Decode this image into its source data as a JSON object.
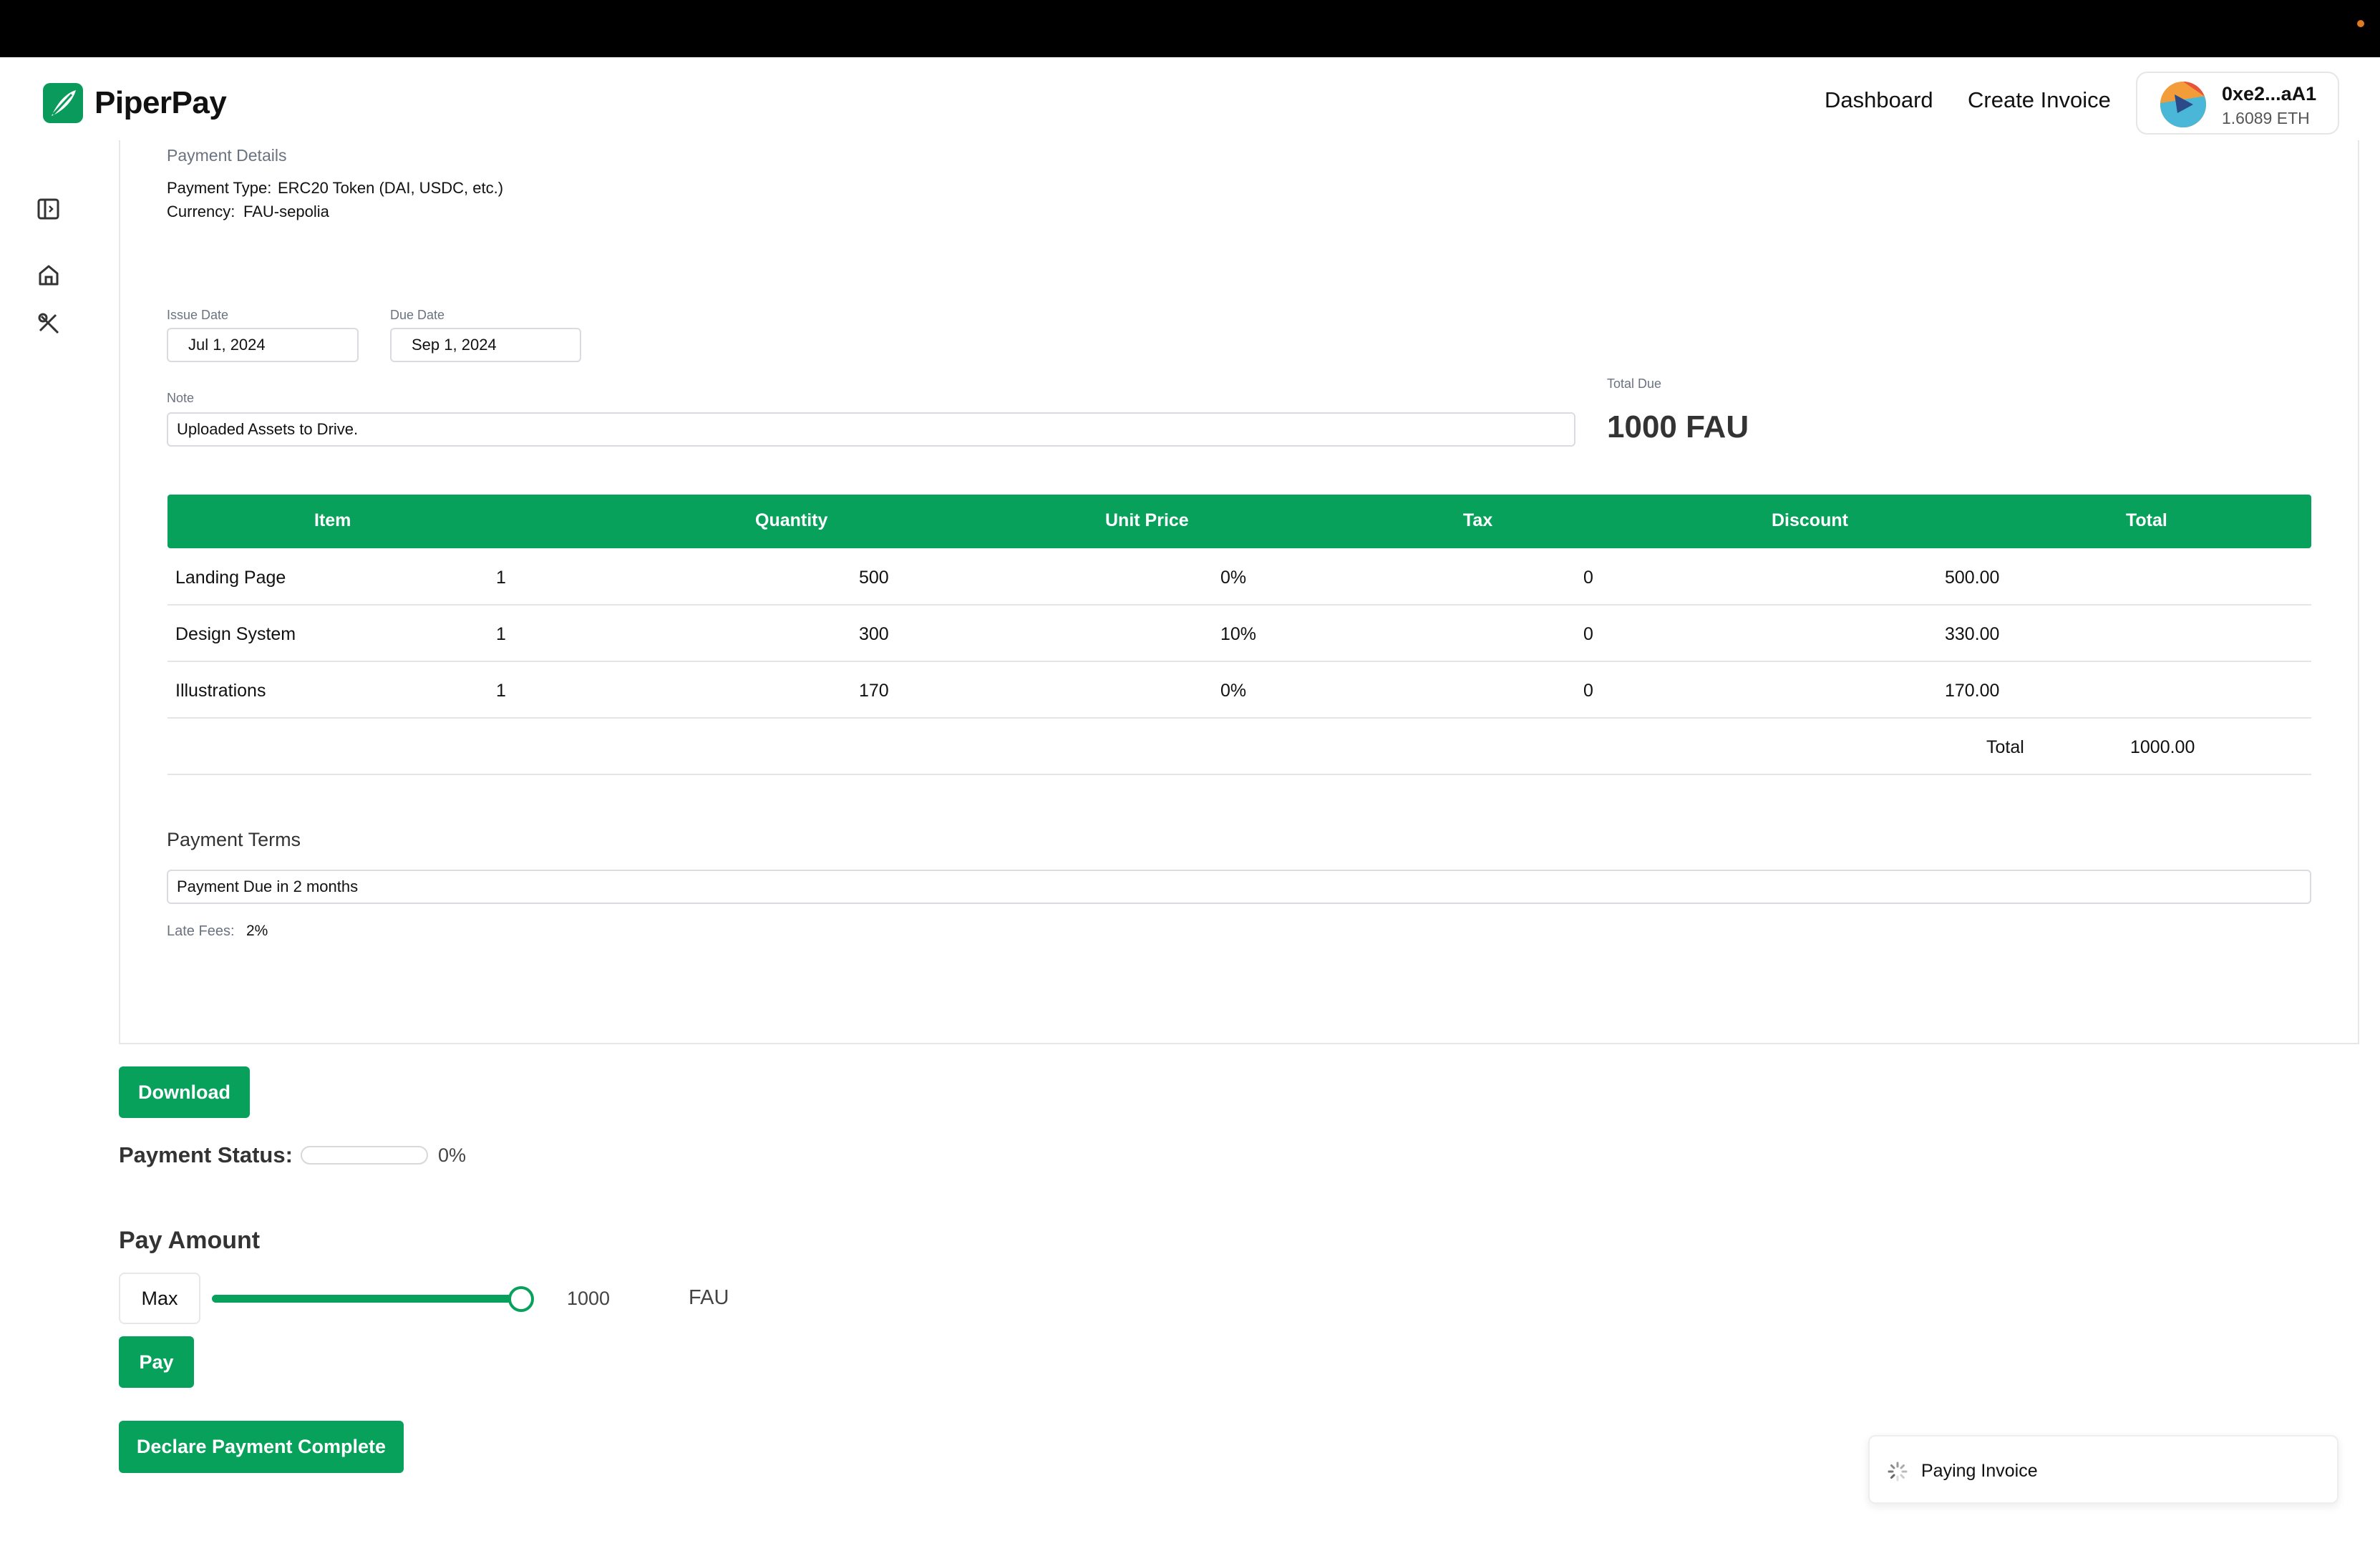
{
  "app": {
    "name": "PiperPay"
  },
  "nav": {
    "dashboard": "Dashboard",
    "create_invoice": "Create Invoice"
  },
  "wallet": {
    "address": "0xe2...aA1",
    "balance": "1.6089 ETH"
  },
  "payment_details": {
    "title": "Payment Details",
    "type_label": "Payment Type:",
    "type_value": "ERC20 Token (DAI, USDC, etc.)",
    "currency_label": "Currency:",
    "currency_value": "FAU-sepolia"
  },
  "dates": {
    "issue_label": "Issue Date",
    "issue_value": "Jul 1, 2024",
    "due_label": "Due Date",
    "due_value": "Sep 1, 2024"
  },
  "note": {
    "label": "Note",
    "value": "Uploaded Assets to Drive."
  },
  "total_due": {
    "label": "Total Due",
    "value": "1000 FAU"
  },
  "table": {
    "headers": [
      "Item",
      "Quantity",
      "Unit Price",
      "Tax",
      "Discount",
      "Total"
    ],
    "rows": [
      [
        "Landing Page",
        "1",
        "500",
        "0%",
        "0",
        "500.00"
      ],
      [
        "Design System",
        "1",
        "300",
        "10%",
        "0",
        "330.00"
      ],
      [
        "Illustrations",
        "1",
        "170",
        "0%",
        "0",
        "170.00"
      ]
    ],
    "total_label": "Total",
    "total_value": "1000.00"
  },
  "terms": {
    "title": "Payment Terms",
    "value": "Payment Due in 2 months",
    "late_label": "Late Fees:",
    "late_value": "2%"
  },
  "actions": {
    "download": "Download"
  },
  "status": {
    "label": "Payment Status:",
    "percent": "0%",
    "progress": 0
  },
  "pay": {
    "title": "Pay Amount",
    "max": "Max",
    "amount": "1000",
    "currency": "FAU",
    "slider_fraction": 1.0,
    "pay_button": "Pay",
    "declare_button": "Declare Payment Complete"
  },
  "toast": {
    "message": "Paying Invoice"
  },
  "colors": {
    "accent": "#07a15c",
    "topbar": "#000000"
  }
}
